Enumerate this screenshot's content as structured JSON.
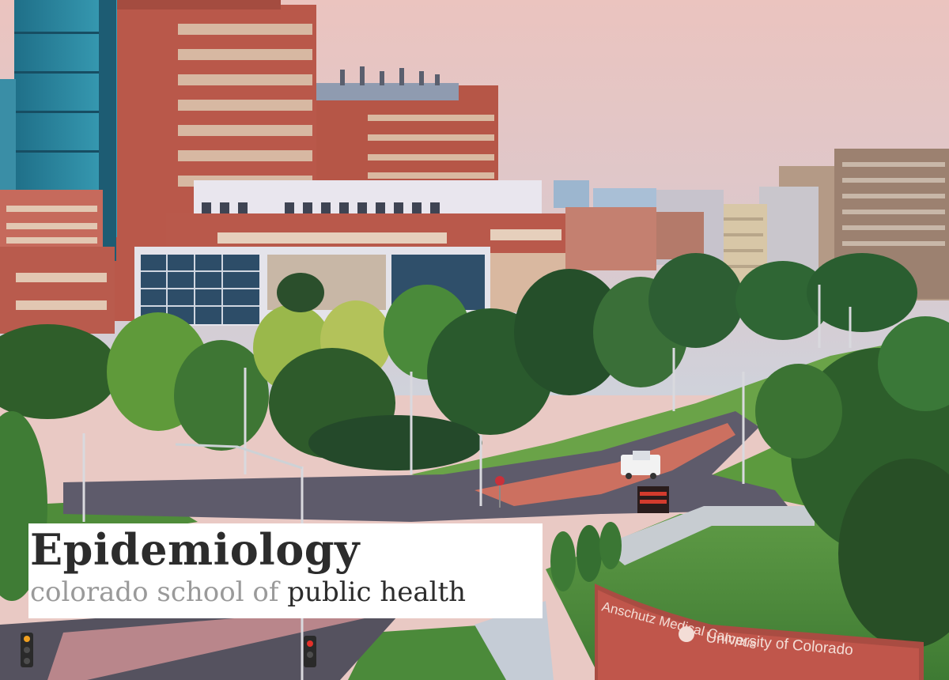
{
  "title_card": {
    "title": "Epidemiology",
    "subtitle_light": "colorado school of ",
    "subtitle_dark": "public health"
  },
  "entrance_sign": {
    "left_text": "Anschutz Medical Campus",
    "right_text": "University of Colorado"
  },
  "palette": {
    "sky_top": "#e8c4c0",
    "sky_bottom": "#d9cfd8",
    "brick": "#b95a4c",
    "glass": "#2f8fa8",
    "foliage": "#3f7a3a",
    "road": "#5d5a6b",
    "sign_red": "#c0504a"
  }
}
